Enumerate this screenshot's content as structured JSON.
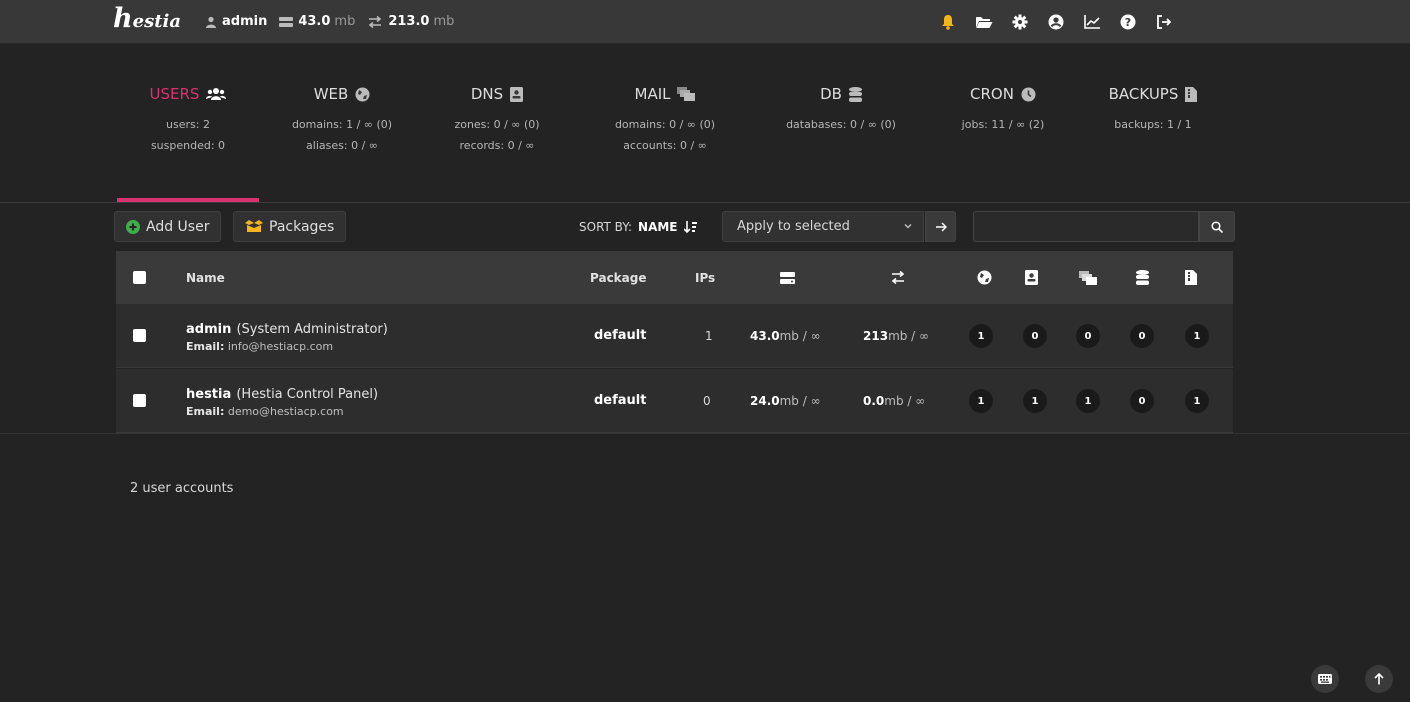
{
  "colors": {
    "accent": "#d9326e",
    "bell": "#f5b51b",
    "add_icon": "#3dae4b",
    "packages_icon": "#f5b51b"
  },
  "topbar": {
    "logo": "Hestia",
    "user": "admin",
    "disk_value": "43.0",
    "disk_unit": "mb",
    "bandwidth_value": "213.0",
    "bandwidth_unit": "mb",
    "icons": [
      "bell-icon",
      "folder-icon",
      "gear-icon",
      "user-circle-icon",
      "chart-icon",
      "help-icon",
      "logout-icon"
    ]
  },
  "tabs": [
    {
      "title": "USERS",
      "icon": "users-icon",
      "lines": [
        "users: 2",
        "suspended: 0"
      ],
      "active": true
    },
    {
      "title": "WEB",
      "icon": "globe-icon",
      "lines": [
        "domains: 1 / ∞ (0)",
        "aliases: 0 / ∞"
      ]
    },
    {
      "title": "DNS",
      "icon": "address-book-icon",
      "lines": [
        "zones: 0 / ∞ (0)",
        "records: 0 / ∞"
      ]
    },
    {
      "title": "MAIL",
      "icon": "mail-bulk-icon",
      "lines": [
        "domains: 0 / ∞ (0)",
        "accounts: 0 / ∞"
      ]
    },
    {
      "title": "DB",
      "icon": "database-icon",
      "lines": [
        "databases: 0 / ∞ (0)"
      ]
    },
    {
      "title": "CRON",
      "icon": "clock-icon",
      "lines": [
        "jobs: 11 / ∞ (2)"
      ]
    },
    {
      "title": "BACKUPS",
      "icon": "file-archive-icon",
      "lines": [
        "backups: 1 / 1"
      ]
    }
  ],
  "toolbar": {
    "add_user": "Add User",
    "packages": "Packages",
    "sort_label": "SORT BY:",
    "sort_value": "NAME",
    "bulk_select": "Apply to selected",
    "search_value": ""
  },
  "table": {
    "headers": {
      "name": "Name",
      "package": "Package",
      "ips": "IPs"
    },
    "header_icons": [
      "disk-icon",
      "bandwidth-icon",
      "globe-icon",
      "address-book-icon",
      "mail-bulk-icon",
      "database-icon",
      "file-archive-icon"
    ],
    "rows": [
      {
        "username": "admin",
        "fullname": "(System Administrator)",
        "email_label": "Email:",
        "email": "info@hestiacp.com",
        "package": "default",
        "ips": "1",
        "disk": "43.0",
        "disk_suffix": "mb / ∞",
        "bandwidth": "213",
        "bandwidth_suffix": "mb / ∞",
        "counts": [
          "1",
          "0",
          "0",
          "0",
          "1"
        ]
      },
      {
        "username": "hestia",
        "fullname": "(Hestia Control Panel)",
        "email_label": "Email:",
        "email": "demo@hestiacp.com",
        "package": "default",
        "ips": "0",
        "disk": "24.0",
        "disk_suffix": "mb / ∞",
        "bandwidth": "0.0",
        "bandwidth_suffix": "mb / ∞",
        "counts": [
          "1",
          "1",
          "1",
          "0",
          "1"
        ]
      }
    ]
  },
  "footer": {
    "count_text": "2 user accounts"
  }
}
